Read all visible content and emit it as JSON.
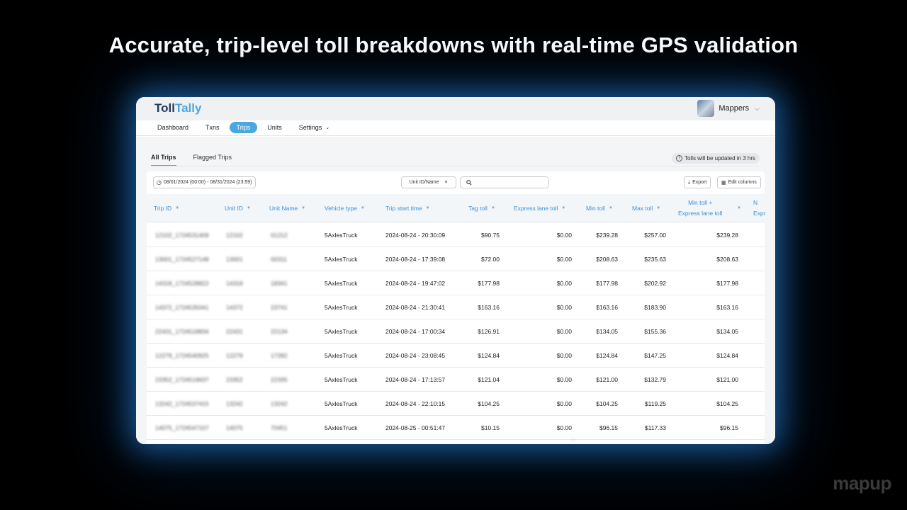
{
  "headline": "Accurate, trip-level toll breakdowns with real-time GPS validation",
  "brand": "mapup",
  "app": {
    "logo_part1": "Toll",
    "logo_part2": "Tally",
    "account_name": "Mappers"
  },
  "nav": [
    {
      "label": "Dashboard"
    },
    {
      "label": "Txns"
    },
    {
      "label": "Trips",
      "active": true
    },
    {
      "label": "Units"
    },
    {
      "label": "Settings"
    }
  ],
  "subtabs": [
    "All Trips",
    "Flagged Trips"
  ],
  "notice": "Tolls will be updated in 3 hrs",
  "filters": {
    "date_range": "08/01/2024 (00:00) - 08/31/2024 (23:59)",
    "unit_select": "Unit ID/Name",
    "search_placeholder": "",
    "export_label": "Export",
    "edit_columns_label": "Edit columns"
  },
  "table": {
    "columns": [
      "Trip ID",
      "Unit ID",
      "Unit Name",
      "Vehicle type",
      "Trip start time",
      "Tag toll",
      "Express lane toll",
      "Min toll",
      "Max toll",
      "Min toll +",
      "Express lane toll",
      "N",
      "Expr"
    ],
    "rows": [
      [
        "12102_1724531409",
        "12102",
        "01212",
        "5AxlesTruck",
        "2024-08-24 - 20:30:09",
        "$90.75",
        "$0.00",
        "$239.28",
        "$257.00",
        "$239.28"
      ],
      [
        "13001_1724527148",
        "13001",
        "00311",
        "5AxlesTruck",
        "2024-08-24 - 17:39:08",
        "$72.00",
        "$0.00",
        "$208.63",
        "$235.63",
        "$208.63"
      ],
      [
        "14318_1724528822",
        "14318",
        "18341",
        "5AxlesTruck",
        "2024-08-24 - 19:47:02",
        "$177.98",
        "$0.00",
        "$177.98",
        "$202.92",
        "$177.98"
      ],
      [
        "14372_1724535041",
        "14372",
        "23741",
        "5AxlesTruck",
        "2024-08-24 - 21:30:41",
        "$163.16",
        "$0.00",
        "$163.16",
        "$183.90",
        "$163.16"
      ],
      [
        "22431_1724518834",
        "22431",
        "22134",
        "5AxlesTruck",
        "2024-08-24 - 17:00:34",
        "$126.91",
        "$0.00",
        "$134.05",
        "$155.36",
        "$134.05"
      ],
      [
        "12279_1724540925",
        "12279",
        "17282",
        "5AxlesTruck",
        "2024-08-24 - 23:08:45",
        "$124.84",
        "$0.00",
        "$124.84",
        "$147.25",
        "$124.84"
      ],
      [
        "23352_1724519637",
        "23352",
        "22335",
        "5AxlesTruck",
        "2024-08-24 - 17:13:57",
        "$121.04",
        "$0.00",
        "$121.00",
        "$132.79",
        "$121.00"
      ],
      [
        "13242_1724537415",
        "13242",
        "13242",
        "5AxlesTruck",
        "2024-08-24 - 22:10:15",
        "$104.25",
        "$0.00",
        "$104.25",
        "$119.25",
        "$104.25"
      ],
      [
        "14075_1724547107",
        "14075",
        "70451",
        "5AxlesTruck",
        "2024-08-25 - 00:51:47",
        "$10.15",
        "$0.00",
        "$96.15",
        "$117.33",
        "$96.15"
      ]
    ]
  }
}
